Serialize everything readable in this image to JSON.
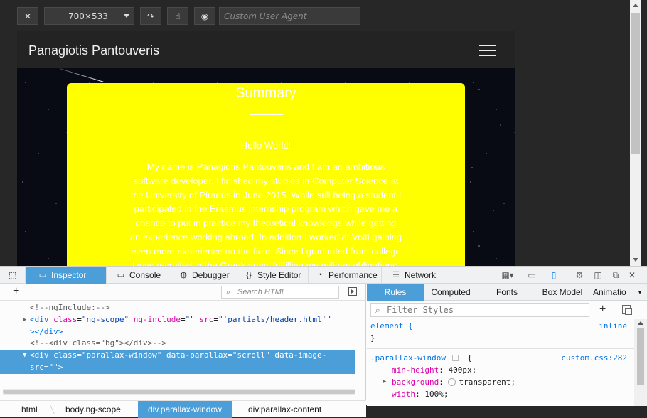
{
  "rdm_toolbar": {
    "size_label": "700×533",
    "user_agent_placeholder": "Custom User Agent",
    "icons": [
      "close-icon",
      "rotate-icon",
      "touch-icon",
      "screenshot-icon"
    ]
  },
  "site": {
    "brand": "Panagiotis Pantouveris",
    "summary_title": "Summary",
    "hello": "Hello World!",
    "body_lines": [
      "My name is Panagiotis Pantouveris and I am an ambitious",
      "software developer. I finished my studies in Computer Science at",
      "the University of Piraeus in June 2015. While still being a student I",
      "participated in the Erasmus internship program which gave me a",
      "chance to put in practice my theoretical knowledge while getting",
      "an experience working abroad. In addition I worked at Volti gaining",
      "even more experience on the field. Since I graduated from college",
      "I was recruited in the Greek army, fulfilling my military obligations."
    ],
    "card_color": "#ffff00"
  },
  "devtools": {
    "tabs": [
      {
        "label": "Inspector",
        "icon": "inspector-icon",
        "active": true
      },
      {
        "label": "Console",
        "icon": "console-icon",
        "active": false
      },
      {
        "label": "Debugger",
        "icon": "debugger-icon",
        "active": false
      },
      {
        "label": "Style Editor",
        "icon": "style-editor-icon",
        "active": false
      },
      {
        "label": "Performance",
        "icon": "performance-icon",
        "active": false
      },
      {
        "label": "Network",
        "icon": "network-icon",
        "active": false
      }
    ],
    "search_placeholder": "Search HTML",
    "markup": [
      {
        "type": "comment",
        "text": "<!--ngInclude:-->"
      },
      {
        "type": "element",
        "twisty": "▶",
        "tag": "div",
        "attrs": [
          [
            "class",
            "ng-scope"
          ],
          [
            "ng-include",
            ""
          ],
          [
            "src",
            "'partials/header.html'"
          ]
        ]
      },
      {
        "type": "close",
        "text": "</div>"
      },
      {
        "type": "comment",
        "text": "<!--<div class=\"bg\"></div>-->"
      },
      {
        "type": "selected",
        "line1": "<div class=\"parallax-window\" data-parallax=\"scroll\" data-image-",
        "line2": "src=\"\">"
      }
    ],
    "breadcrumbs": [
      "html",
      "body.ng-scope",
      "div.parallax-window",
      "div.parallax-content"
    ],
    "active_crumb": "div.parallax-window",
    "side_tabs": [
      "Rules",
      "Computed",
      "Fonts",
      "Box Model",
      "Animatio"
    ],
    "filter_placeholder": "Filter Styles",
    "rules": {
      "element_selector": "element {",
      "element_source": "inline",
      "close": "}",
      "selector": ".parallax-window",
      "open": "{",
      "source": "custom.css:282",
      "props": [
        {
          "name": "min-height",
          "value": "400px"
        },
        {
          "name": "background",
          "value": "transparent"
        },
        {
          "name": "width",
          "value": "100%"
        }
      ]
    },
    "accent": "#4c9ed9"
  }
}
